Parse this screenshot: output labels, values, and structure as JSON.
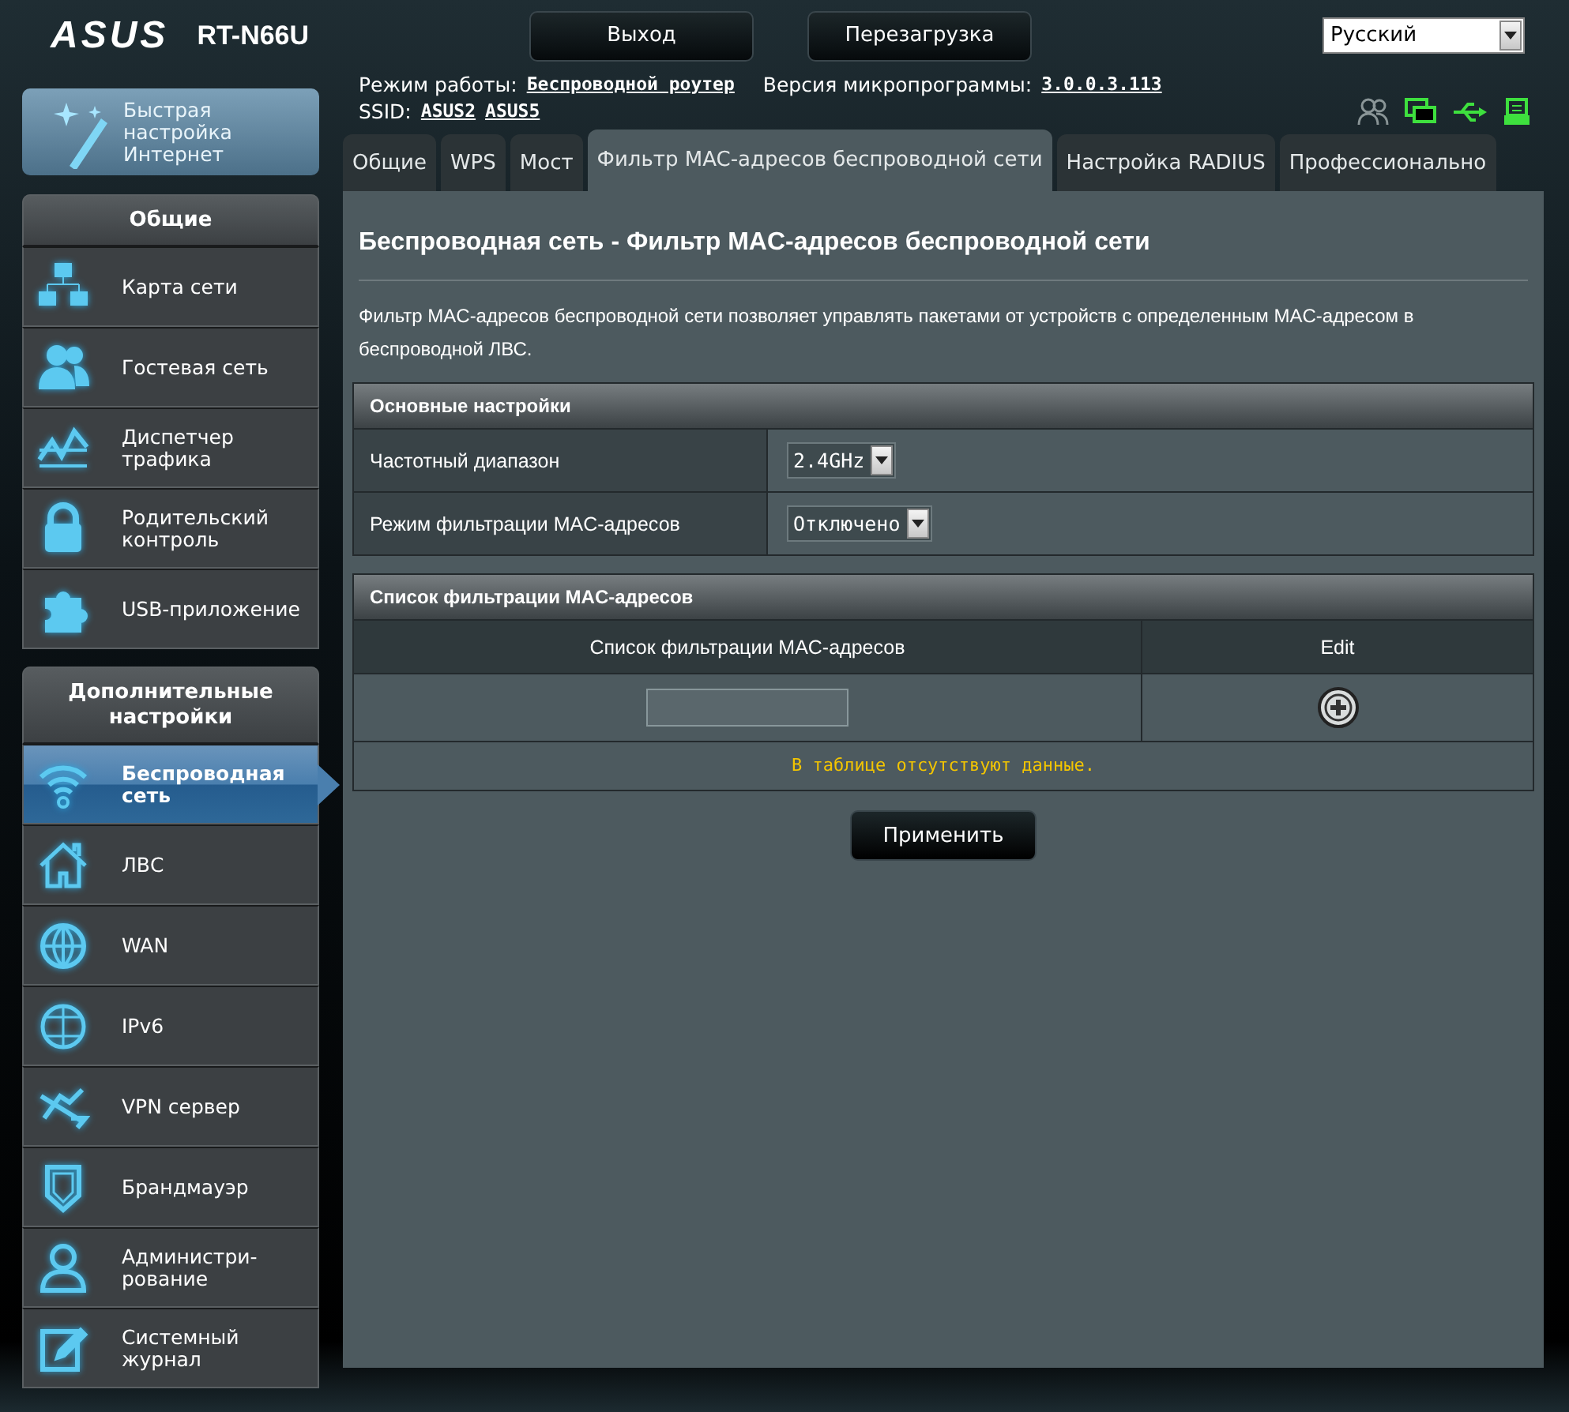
{
  "header": {
    "logo": "ASUS",
    "model": "RT-N66U",
    "buttons": [
      "Выход",
      "Перезагрузка"
    ],
    "language": "Русский"
  },
  "info": {
    "mode_label": "Режим работы:",
    "mode_value": "Беспроводной роутер",
    "firmware_label": "Версия микропрограммы:",
    "firmware_value": "3.0.0.3.113",
    "ssid_label": "SSID:",
    "ssids": [
      "ASUS2",
      "ASUS5"
    ]
  },
  "quick_setup": {
    "label": "Быстрая\nнастройка\nИнтернет"
  },
  "sidebar": [
    {
      "title": "Общие",
      "items": [
        {
          "label": "Карта сети",
          "selected": false
        },
        {
          "label": "Гостевая сеть",
          "selected": false
        },
        {
          "label": "Диспетчер\nтрафика",
          "selected": false
        },
        {
          "label": "Родительский\nконтроль",
          "selected": false
        },
        {
          "label": "USB-приложение",
          "selected": false
        }
      ]
    },
    {
      "title": "Дополнительные\nнастройки",
      "items": [
        {
          "label": "Беспроводная\nсеть",
          "selected": true
        },
        {
          "label": "ЛВС",
          "selected": false
        },
        {
          "label": "WAN",
          "selected": false
        },
        {
          "label": "IPv6",
          "selected": false
        },
        {
          "label": "VPN сервер",
          "selected": false
        },
        {
          "label": "Брандмауэр",
          "selected": false
        },
        {
          "label": "Администри-\nрование",
          "selected": false
        },
        {
          "label": "Системный\nжурнал",
          "selected": false
        }
      ]
    }
  ],
  "tabs": [
    {
      "label": "Общие",
      "selected": false
    },
    {
      "label": "WPS",
      "selected": false
    },
    {
      "label": "Мост",
      "selected": false
    },
    {
      "label": "Фильтр MAC-адресов беспроводной сети",
      "selected": true
    },
    {
      "label": "Настройка RADIUS",
      "selected": false
    },
    {
      "label": "Профессионально",
      "selected": false
    }
  ],
  "content": {
    "title": "Беспроводная сеть - Фильтр MAC-адресов беспроводной сети",
    "description": "Фильтр MAC-адресов беспроводной сети позволяет управлять пакетами от устройств с определенным MAC-адресом в беспроводной ЛВС.",
    "basic": {
      "header": "Основные настройки",
      "rows": [
        {
          "label": "Частотный диапазон",
          "value": "2.4GHz"
        },
        {
          "label": "Режим фильтрации MAC-адресов",
          "value": "Отключено"
        }
      ]
    },
    "list": {
      "header": "Список фильтрации MAC-адресов",
      "columns": [
        "Список фильтрации MAC-адресов",
        "Edit"
      ],
      "empty_message": "В таблице отсутствуют данные."
    },
    "apply_button": "Применить"
  }
}
